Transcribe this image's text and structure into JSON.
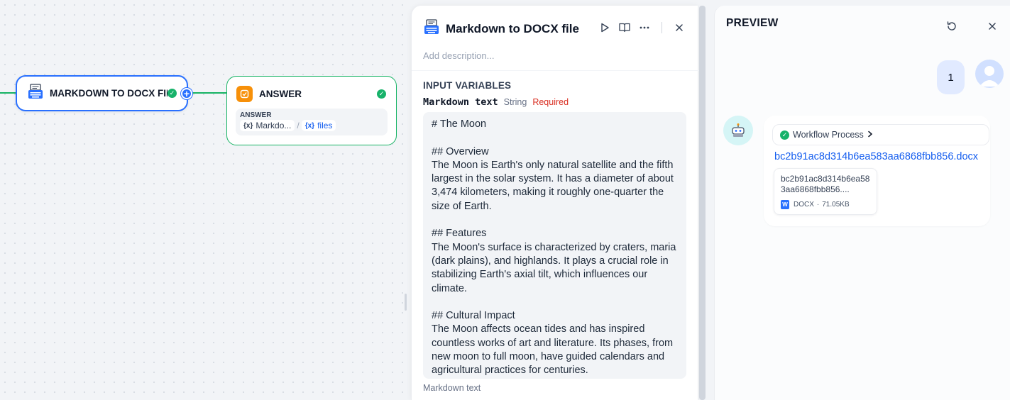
{
  "canvas": {
    "md_node": {
      "title": "MARKDOWN TO DOCX FIL"
    },
    "answer_node": {
      "title": "ANSWER",
      "box_label": "ANSWER",
      "var1": "Markdo...",
      "var_sep": "/",
      "var2": "files",
      "var_icon": "{x}"
    }
  },
  "panel": {
    "title": "Markdown to DOCX file",
    "description_placeholder": "Add description...",
    "section_title": "INPUT VARIABLES",
    "field": {
      "name": "Markdown text",
      "type": "String",
      "required": "Required",
      "value": "# The Moon\n\n## Overview\nThe Moon is Earth's only natural satellite and the fifth largest in the solar system. It has a diameter of about 3,474 kilometers, making it roughly one-quarter the size of Earth.\n\n## Features\nThe Moon's surface is characterized by craters, maria (dark plains), and highlands. It plays a crucial role in stabilizing Earth's axial tilt, which influences our climate.\n\n## Cultural Impact\nThe Moon affects ocean tides and has inspired countless works of art and literature. Its phases, from new moon to full moon, have guided calendars and agricultural practices for centuries.",
      "hint": "Markdown text"
    }
  },
  "preview": {
    "title": "PREVIEW",
    "user_message": "1",
    "workflow_label": "Workflow Process",
    "file_link": "bc2b91ac8d314b6ea583aa6868fbb856.docx",
    "file_card": {
      "name": "bc2b91ac8d314b6ea583aa6868fbb856....",
      "type": "DOCX",
      "dot": "·",
      "size": "71.05KB"
    }
  },
  "colors": {
    "accent": "#2970ff",
    "success": "#17b26a",
    "answer_icon": "#f79009",
    "required": "#d92d20",
    "link": "#155eef"
  },
  "icons": [
    "typewriter-icon",
    "check-icon",
    "plus-icon",
    "answer-icon",
    "variable-icon",
    "play-icon",
    "book-icon",
    "more-icon",
    "close-icon",
    "refresh-icon",
    "robot-icon",
    "user-avatar-icon",
    "chevron-right-icon",
    "docx-icon"
  ]
}
